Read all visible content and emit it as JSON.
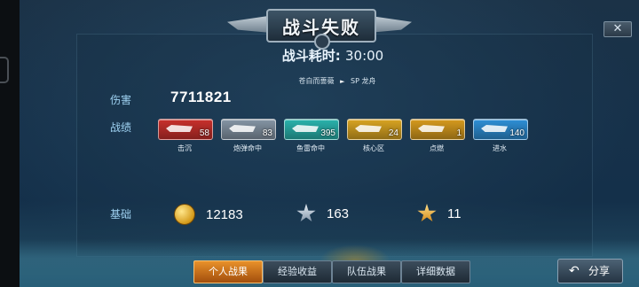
{
  "banner": {
    "title": "战斗失败"
  },
  "close": {
    "label": "✕"
  },
  "battle": {
    "duration_label": "战斗耗时:",
    "duration_value": "30:00",
    "player_name": "苍白而蔷薇",
    "ship_name": "SP 龙舟"
  },
  "labels": {
    "damage": "伤害",
    "record": "战绩",
    "base": "基础"
  },
  "damage_value": "7711821",
  "record_badges": [
    {
      "label": "击沉",
      "value": "58",
      "color": "#c8302c",
      "icon": "sink-icon"
    },
    {
      "label": "炮弹命中",
      "value": "83",
      "color": "#8595a5",
      "icon": "shell-hit-icon"
    },
    {
      "label": "鱼雷命中",
      "value": "395",
      "color": "#2ab3ad",
      "icon": "torpedo-hit-icon"
    },
    {
      "label": "核心区",
      "value": "24",
      "color": "#d9a422",
      "icon": "citadel-icon"
    },
    {
      "label": "点燃",
      "value": "1",
      "color": "#d69a1e",
      "icon": "fire-icon"
    },
    {
      "label": "进水",
      "value": "140",
      "color": "#2e8fd6",
      "icon": "flooding-icon"
    }
  ],
  "base_stats": [
    {
      "icon": "coin-icon",
      "value": "12183"
    },
    {
      "icon": "silver-star-icon",
      "value": "163"
    },
    {
      "icon": "gold-star-icon",
      "value": "11"
    }
  ],
  "tabs": [
    {
      "label": "个人战果",
      "active": true
    },
    {
      "label": "经验收益",
      "active": false
    },
    {
      "label": "队伍战果",
      "active": false
    },
    {
      "label": "详细数据",
      "active": false
    }
  ],
  "share": {
    "label": "分享"
  }
}
